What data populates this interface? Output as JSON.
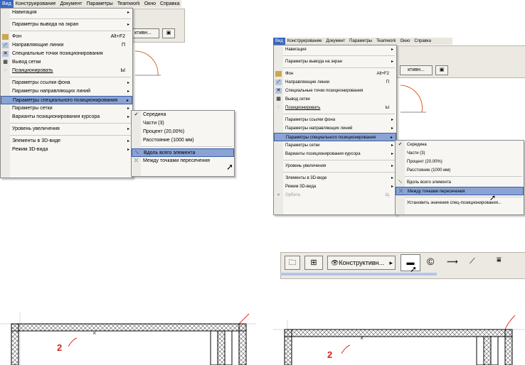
{
  "left_menu": {
    "menubar": [
      "Вид",
      "Конструирование",
      "Документ",
      "Параметры",
      "Teamwork",
      "Окно",
      "Справка"
    ],
    "items": [
      {
        "label": "Навигация",
        "arrow": "▸"
      },
      {
        "label": "Параметры вывода на экран",
        "arrow": "▸"
      },
      {
        "label": "Фон",
        "shortcut": "Alt+F2"
      },
      {
        "label": "Направляющие линии",
        "shortcut": "П"
      },
      {
        "label": "Специальные точки позиционирования"
      },
      {
        "label": "Вывод сетки"
      },
      {
        "label": "Позиционировать",
        "shortcut": "Ы"
      },
      {
        "label": "Параметры ссылки фона",
        "arrow": "▸"
      },
      {
        "label": "Параметры направляющих линий",
        "arrow": "▸"
      },
      {
        "label": "Параметры специального позиционирования",
        "arrow": "▸"
      },
      {
        "label": "Параметры сетки",
        "arrow": "▸"
      },
      {
        "label": "Варианты позиционирования курсора",
        "arrow": "▸"
      },
      {
        "label": "Уровень увеличения",
        "arrow": "▸"
      },
      {
        "label": "Элементы в 3D-виде",
        "arrow": "▸"
      },
      {
        "label": "Режим 3D-вида",
        "arrow": "▸"
      }
    ],
    "submenu": [
      "Середина",
      "Части (3)",
      "Процент (20,00%)",
      "Расстояние (1000 мм)",
      "Вдоль всего элемента",
      "Между точками пересечения"
    ],
    "toolbar_text": "ктивн..."
  },
  "right_menu": {
    "menubar": [
      "Вид",
      "Конструирование",
      "Документ",
      "Параметры",
      "Teamwork",
      "Окно",
      "Справка"
    ],
    "items": [
      {
        "label": "Навигация",
        "arrow": "▸"
      },
      {
        "label": "Параметры вывода на экран",
        "arrow": "▸"
      },
      {
        "label": "Фон",
        "shortcut": "Alt+F2"
      },
      {
        "label": "Направляющие линии",
        "shortcut": "П"
      },
      {
        "label": "Специальные точки позиционирования"
      },
      {
        "label": "Вывод сетки"
      },
      {
        "label": "Позиционировать",
        "shortcut": "Ы"
      },
      {
        "label": "Параметры ссылки фона",
        "arrow": "▸"
      },
      {
        "label": "Параметры направляющих линий",
        "arrow": "▸"
      },
      {
        "label": "Параметры специального позиционирования",
        "arrow": "▸"
      },
      {
        "label": "Параметры сетки",
        "arrow": "▸"
      },
      {
        "label": "Варианты позиционирования курсора",
        "arrow": "▸"
      },
      {
        "label": "Уровень увеличения",
        "arrow": "▸"
      },
      {
        "label": "Элементы в 3D-виде",
        "arrow": "▸"
      },
      {
        "label": "Режим 3D-вида",
        "arrow": "▸"
      },
      {
        "label": "Орбита",
        "shortcut": "Щ"
      }
    ],
    "submenu": [
      "Середина",
      "Части (3)",
      "Процент (20,00%)",
      "Расстояние (1000 мм)",
      "Вдоль всего элемента",
      "Между точками пересечения",
      "Установить значения спец-позиционирования..."
    ],
    "toolbar_text": "ктивн..."
  },
  "toolbar_zoom": {
    "label": "Конструктивн..."
  },
  "drawings": {
    "left_label": "2",
    "right_label": "2"
  }
}
